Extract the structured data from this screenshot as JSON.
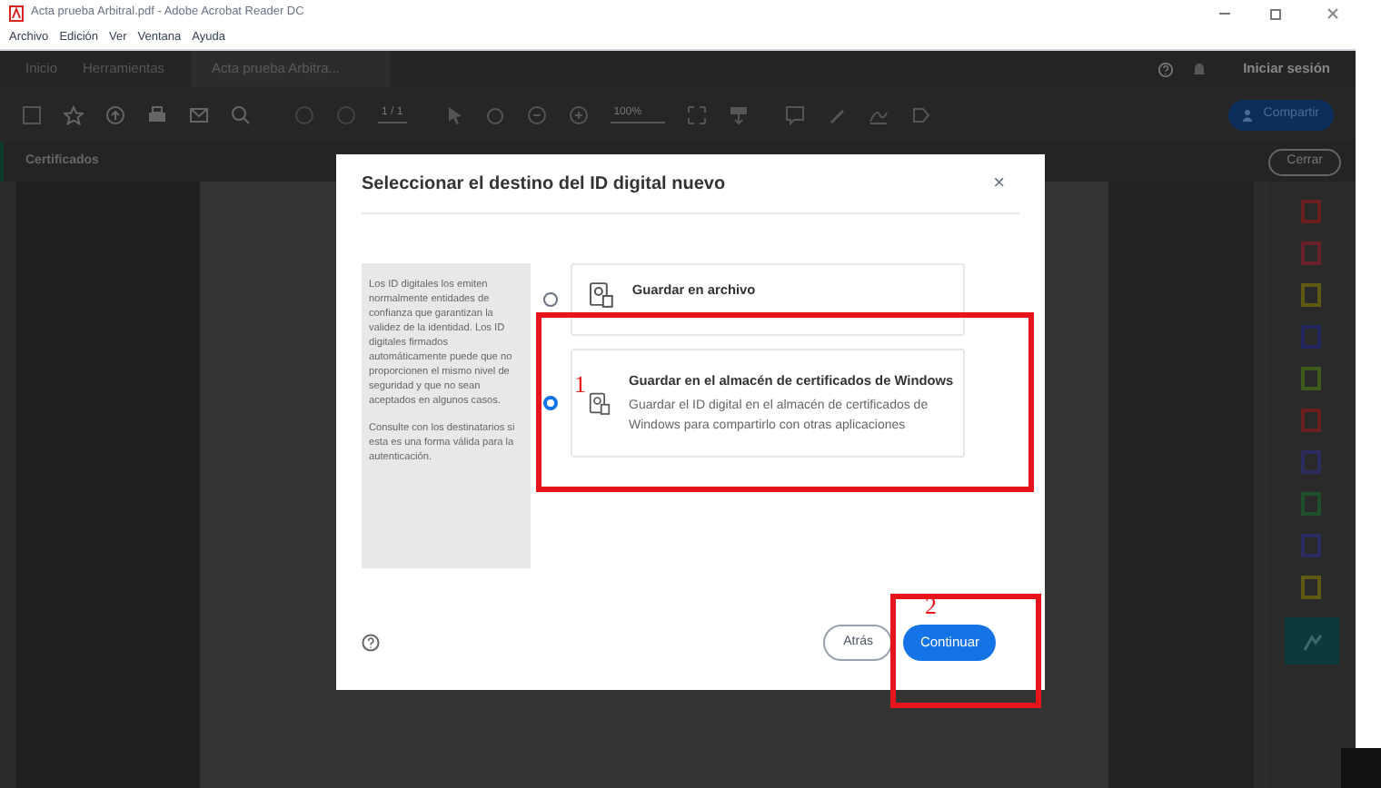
{
  "window": {
    "title": "Acta prueba Arbitral.pdf - Adobe Acrobat Reader DC"
  },
  "menu": [
    "Archivo",
    "Edición",
    "Ver",
    "Ventana",
    "Ayuda"
  ],
  "tabs": [
    {
      "label": "Inicio",
      "selected": false
    },
    {
      "label": "Herramientas",
      "selected": false
    },
    {
      "label": "Acta prueba Arbitra...",
      "selected": true
    }
  ],
  "sign_in": "Iniciar sesión",
  "toolbar": {
    "page": "1 / 1",
    "zoom": "100%",
    "share": "Compartir"
  },
  "panel": {
    "title": "Certificados",
    "close": "Cerrar"
  },
  "dialog": {
    "title": "Seleccionar el destino del ID digital nuevo",
    "close": "×",
    "info": [
      "Los ID digitales los emiten normalmente entidades de confianza que garantizan la validez de la identidad. Los ID digitales firmados automáticamente puede que no proporcionen el mismo nivel de seguridad y que no sean aceptados en algunos casos.",
      "Consulte con los destinatarios si esta es una forma válida para la autenticación."
    ],
    "options": [
      {
        "title": "Guardar en archivo",
        "selected": false
      },
      {
        "title": "Guardar en el almacén de certificados de Windows",
        "description": "Guardar el ID digital en el almacén de certificados de Windows para compartirlo con otras aplicaciones",
        "selected": true
      }
    ],
    "back": "Atrás",
    "continue": "Continuar"
  },
  "annotations": [
    {
      "label": "1"
    },
    {
      "label": "2"
    }
  ]
}
